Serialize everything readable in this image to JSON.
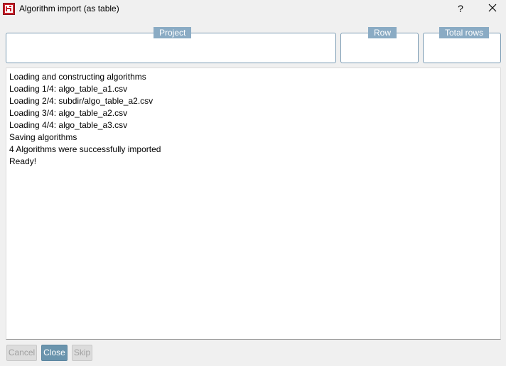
{
  "window": {
    "title": "Algorithm import (as table)",
    "help_label": "?"
  },
  "groups": {
    "project": {
      "label": "Project"
    },
    "row": {
      "label": "Row"
    },
    "total_rows": {
      "label": "Total rows"
    }
  },
  "log": {
    "lines": [
      "Loading and constructing algorithms",
      "Loading 1/4: algo_table_a1.csv",
      "Loading 2/4: subdir/algo_table_a2.csv",
      "Loading 3/4: algo_table_a2.csv",
      "Loading 4/4: algo_table_a3.csv",
      "Saving algorithms",
      "4 Algorithms were successfully imported",
      "Ready!"
    ]
  },
  "buttons": {
    "cancel": "Cancel",
    "close": "Close",
    "skip": "Skip"
  },
  "icons": {
    "app": "app-logo-icon",
    "help": "help-icon",
    "close": "close-icon"
  },
  "colors": {
    "accent": "#6a94ad",
    "legend_bg": "#8aabc4",
    "app_icon_red": "#c8202a"
  }
}
